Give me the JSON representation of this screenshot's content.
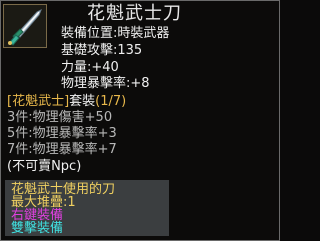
{
  "item": {
    "icon": "sword-icon",
    "name": "花魁武士刀",
    "stats": [
      "裝備位置:時裝武器",
      "基礎攻擊:135",
      "力量:+40",
      "物理暴擊率:+8"
    ],
    "set": {
      "name": "[花魁武士]",
      "label": "套裝",
      "count": "(1/7)"
    },
    "set_bonuses": [
      "3件:物理傷害+50",
      "5件:物理暴擊率+3",
      "7件:物理暴擊率+7"
    ],
    "tradable": "(不可賣Npc)",
    "description": "花魁武士使用的刀",
    "stack": "最大堆疊:1",
    "action_right_click": "右鍵裝備",
    "action_double_click": "雙擊裝備"
  },
  "colors": {
    "set_name": "#e8b84b",
    "description": "#f0d060",
    "right_click": "#e040e0",
    "double_click": "#40e0e0"
  }
}
